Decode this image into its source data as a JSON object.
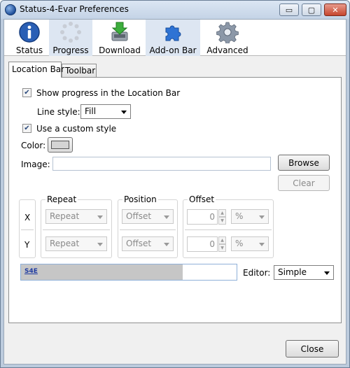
{
  "window": {
    "title": "Status-4-Evar Preferences",
    "minimize_glyph": "▭",
    "maximize_glyph": "▢",
    "close_glyph": "✕"
  },
  "toolbar": {
    "items": [
      {
        "label": "Status",
        "icon": "info-icon"
      },
      {
        "label": "Progress",
        "icon": "progress-icon",
        "selected": true
      },
      {
        "label": "Download",
        "icon": "download-icon"
      },
      {
        "label": "Add-on Bar",
        "icon": "puzzle-icon"
      },
      {
        "label": "Advanced",
        "icon": "gear-icon"
      }
    ]
  },
  "tabs": [
    {
      "label": "Location Bar",
      "active": true
    },
    {
      "label": "Toolbar",
      "active": false
    }
  ],
  "location_bar": {
    "show_progress": {
      "label": "Show progress in the Location Bar",
      "checked": true
    },
    "line_style": {
      "label": "Line style:",
      "value": "Fill"
    },
    "custom_style": {
      "label": "Use a custom style",
      "checked": true
    },
    "color_label": "Color:",
    "color_value": "#d4d4d4",
    "image_label": "Image:",
    "image_value": "",
    "browse_label": "Browse",
    "clear_label": "Clear",
    "axes": [
      "X",
      "Y"
    ],
    "repeat": {
      "header": "Repeat",
      "values": [
        "Repeat",
        "Repeat"
      ]
    },
    "position": {
      "header": "Position",
      "values": [
        "Offset",
        "Offset"
      ]
    },
    "offset": {
      "header": "Offset",
      "values": [
        "0",
        "0"
      ],
      "units": [
        "%",
        "%"
      ]
    },
    "preview": {
      "tag": "S4E",
      "progress_fraction": 0.75
    },
    "editor": {
      "label": "Editor:",
      "value": "Simple"
    }
  },
  "footer": {
    "close_label": "Close"
  }
}
